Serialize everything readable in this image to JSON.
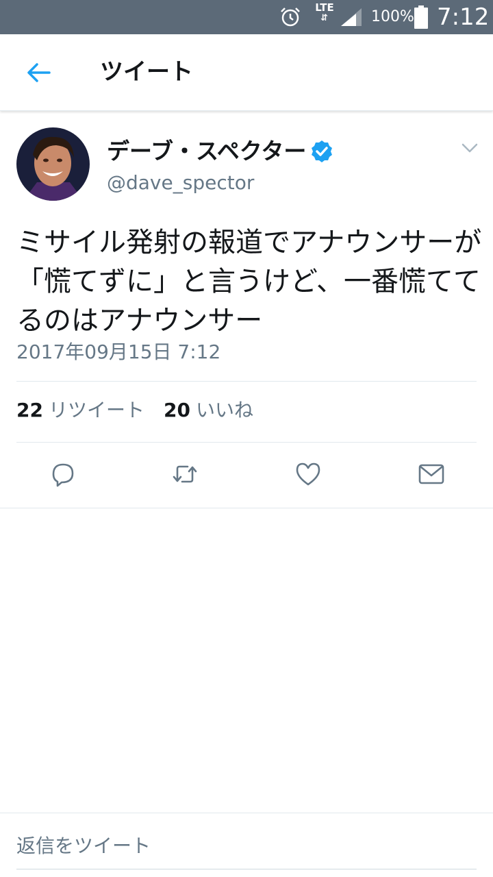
{
  "status_bar": {
    "network": "LTE",
    "battery_percent": "100%",
    "time": "7:12"
  },
  "header": {
    "title": "ツイート"
  },
  "tweet": {
    "display_name": "デーブ・スペクター",
    "handle": "@dave_spector",
    "verified": true,
    "text": "ミサイル発射の報道でアナウンサーが「慌てずに」と言うけど、一番慌ててるのはアナウンサー",
    "timestamp": "2017年09月15日 7:12",
    "retweet_count": "22",
    "retweet_label": "リツイート",
    "like_count": "20",
    "like_label": "いいね"
  },
  "reply": {
    "placeholder": "返信をツイート"
  },
  "colors": {
    "status_bar": "#5c6a78",
    "accent": "#1da1f2",
    "secondary_text": "#657786",
    "divider": "#e1e8ed"
  },
  "icons": [
    "alarm-icon",
    "signal-icon",
    "battery-icon",
    "back-arrow-icon",
    "verified-badge-icon",
    "chevron-down-icon",
    "reply-icon",
    "retweet-icon",
    "like-icon",
    "dm-icon"
  ]
}
